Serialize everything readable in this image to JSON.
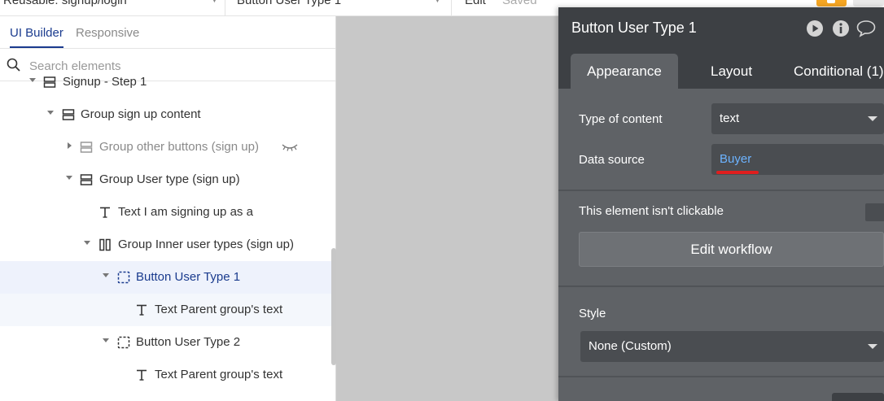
{
  "topbar": {
    "page_name": "Reusable: signup/login",
    "element_name": "Button User Type 1",
    "edit_label": "Edit",
    "saved_label": "Saved"
  },
  "left_panel": {
    "tabs": {
      "ui_builder": "UI Builder",
      "responsive": "Responsive"
    },
    "search_placeholder": "Search elements",
    "tree": [
      {
        "label": "Signup - Step 1",
        "icon": "group-icon"
      },
      {
        "label": "Group sign up content",
        "icon": "group-icon"
      },
      {
        "label": "Group other buttons (sign up)",
        "icon": "group-icon",
        "hidden": true
      },
      {
        "label": "Group User type (sign up)",
        "icon": "group-icon"
      },
      {
        "label": "Text I am signing up as a",
        "icon": "text-icon"
      },
      {
        "label": "Group Inner user types (sign up)",
        "icon": "columns-icon"
      },
      {
        "label": "Button User Type 1",
        "icon": "button-icon",
        "selected": true
      },
      {
        "label": "Text Parent group's text",
        "icon": "text-icon"
      },
      {
        "label": "Button User Type 2",
        "icon": "button-icon"
      },
      {
        "label": "Text Parent group's text",
        "icon": "text-icon"
      }
    ]
  },
  "editor": {
    "title": "Button User Type 1",
    "header_icons": [
      "play-icon",
      "info-icon",
      "comment-icon"
    ],
    "tabs": [
      "Appearance",
      "Layout",
      "Conditional (1)"
    ],
    "type_of_content": {
      "label": "Type of content",
      "value": "text"
    },
    "data_source": {
      "label": "Data source",
      "value": "Buyer"
    },
    "not_clickable_label": "This element isn't clickable",
    "edit_workflow_label": "Edit workflow",
    "style": {
      "label": "Style",
      "value": "None (Custom)"
    }
  },
  "colors": {
    "accent_blue": "#1a3b8e",
    "editor_bg": "#5f6266",
    "editor_header": "#3d4044",
    "link_blue": "#6cb3ff",
    "annotation_red": "#e01e1e",
    "publish_orange": "#f5a623"
  }
}
